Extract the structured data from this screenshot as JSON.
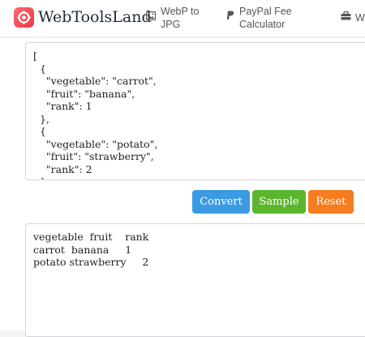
{
  "header": {
    "brand": "WebToolsLand",
    "nav": [
      {
        "label": "WebP to\nJPG",
        "icon": "image-icon"
      },
      {
        "label": "PayPal Fee\nCalculator",
        "icon": "paypal-icon"
      },
      {
        "label": "W",
        "icon": "toolbox-icon"
      }
    ]
  },
  "input": {
    "value": "[\n  {\n    \"vegetable\": \"carrot\",\n    \"fruit\": \"banana\",\n    \"rank\": 1\n  },\n  {\n    \"vegetable\": \"potato\",\n    \"fruit\": \"strawberry\",\n    \"rank\": 2\n  }\n]"
  },
  "actions": {
    "convert_label": "Convert",
    "sample_label": "Sample",
    "reset_label": "Reset"
  },
  "output": {
    "value": "vegetable  fruit    rank\ncarrot  banana     1\npotato strawberry     2"
  },
  "colors": {
    "convert": "#3b9ae1",
    "sample": "#5cb52f",
    "reset": "#f57c1f",
    "brand": "#e8394c"
  }
}
